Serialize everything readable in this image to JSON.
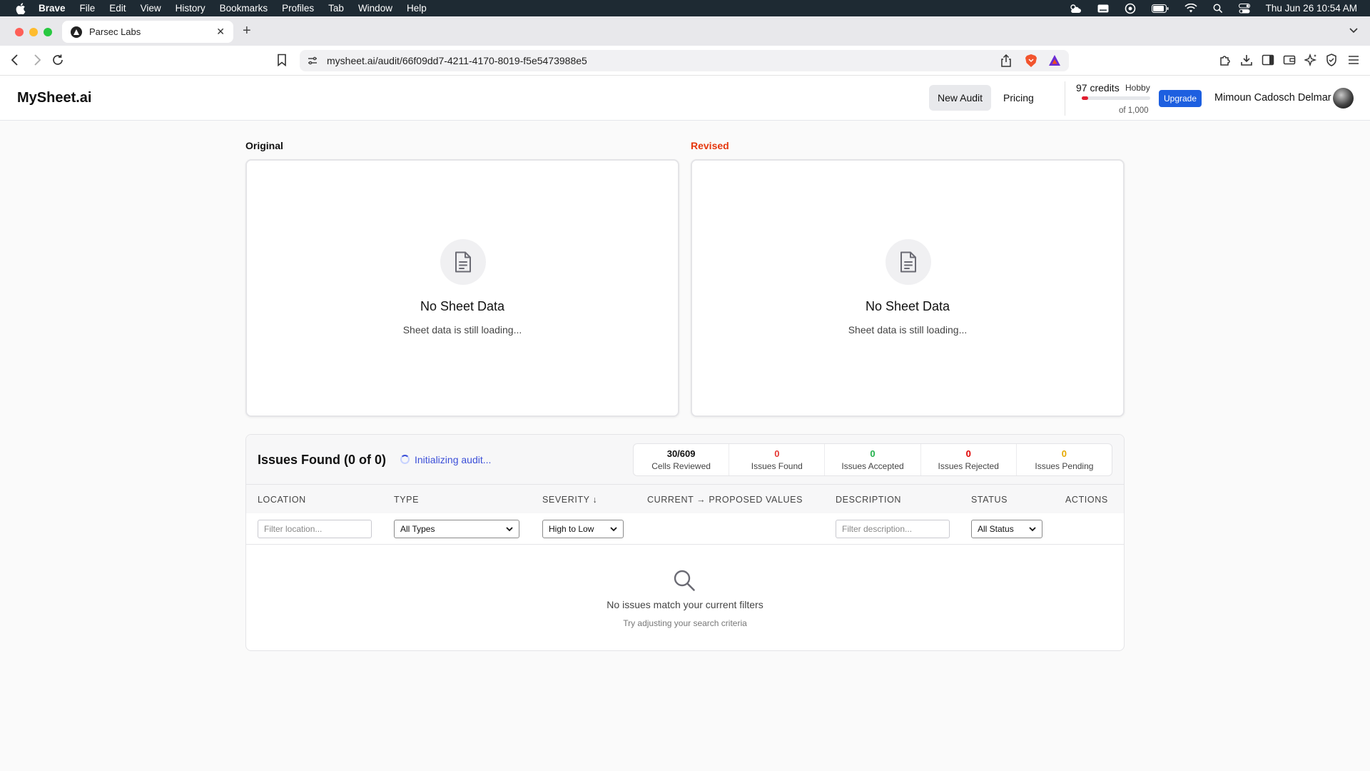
{
  "menubar": {
    "app": "Brave",
    "items": [
      "File",
      "Edit",
      "View",
      "History",
      "Bookmarks",
      "Profiles",
      "Tab",
      "Window",
      "Help"
    ],
    "clock": "Thu Jun 26  10:54 AM"
  },
  "browser": {
    "tab_title": "Parsec Labs",
    "url": "mysheet.ai/audit/66f09dd7-4211-4170-8019-f5e5473988e5"
  },
  "header": {
    "brand": "MySheet.ai",
    "new_audit": "New Audit",
    "pricing": "Pricing",
    "credits": "97 credits",
    "plan": "Hobby",
    "credit_total": "of 1,000",
    "credit_fraction": 0.097,
    "upgrade": "Upgrade",
    "user_name": "Mimoun Cadosch Delmar"
  },
  "original": {
    "label": "Original",
    "empty_title": "No Sheet Data",
    "empty_sub": "Sheet data is still loading..."
  },
  "revised": {
    "label": "Revised",
    "empty_title": "No Sheet Data",
    "empty_sub": "Sheet data is still loading..."
  },
  "issues": {
    "title": "Issues Found (0 of 0)",
    "status": "Initializing audit...",
    "stats": [
      {
        "value": "30/609",
        "label": "Cells Reviewed",
        "color": "#111111"
      },
      {
        "value": "0",
        "label": "Issues Found",
        "color": "#e53935"
      },
      {
        "value": "0",
        "label": "Issues Accepted",
        "color": "#22b14c"
      },
      {
        "value": "0",
        "label": "Issues Rejected",
        "color": "#e00000"
      },
      {
        "value": "0",
        "label": "Issues Pending",
        "color": "#e5a800"
      }
    ],
    "columns": {
      "location": "LOCATION",
      "type": "TYPE",
      "severity": "SEVERITY ↓",
      "values": "CURRENT → PROPOSED VALUES",
      "description": "DESCRIPTION",
      "status": "STATUS",
      "actions": "ACTIONS"
    },
    "filters": {
      "location_placeholder": "Filter location...",
      "type_selected": "All Types",
      "severity_selected": "High to Low",
      "description_placeholder": "Filter description...",
      "status_selected": "All Status"
    },
    "empty_title": "No issues match your current filters",
    "empty_sub": "Try adjusting your search criteria"
  }
}
